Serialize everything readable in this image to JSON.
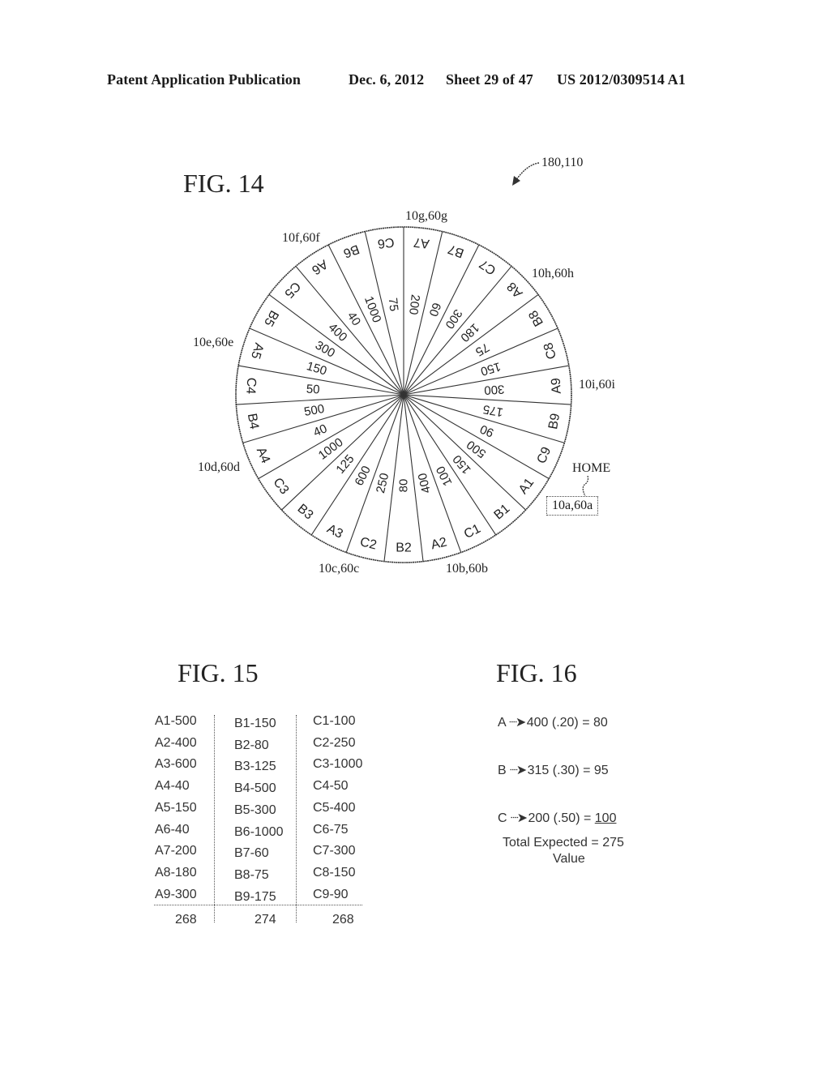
{
  "header": {
    "publication": "Patent Application Publication",
    "date": "Dec. 6, 2012",
    "sheet": "Sheet 29 of 47",
    "number": "US 2012/0309514 A1"
  },
  "fig14": {
    "title": "FIG. 14",
    "ref_label": "180,110",
    "home_label": "HOME",
    "home_ref": "10a,60a",
    "position_labels": {
      "b": "10b,60b",
      "c": "10c,60c",
      "d": "10d,60d",
      "e": "10e,60e",
      "f": "10f,60f",
      "g": "10g,60g",
      "h": "10h,60h",
      "i": "10i,60i"
    },
    "segments": [
      {
        "label": "A7",
        "value": "200"
      },
      {
        "label": "B7",
        "value": "60"
      },
      {
        "label": "C7",
        "value": "300"
      },
      {
        "label": "A8",
        "value": "180"
      },
      {
        "label": "B8",
        "value": "75"
      },
      {
        "label": "C8",
        "value": "150"
      },
      {
        "label": "A9",
        "value": "300"
      },
      {
        "label": "B9",
        "value": "175"
      },
      {
        "label": "C9",
        "value": "90"
      },
      {
        "label": "A1",
        "value": "500"
      },
      {
        "label": "B1",
        "value": "150"
      },
      {
        "label": "C1",
        "value": "100"
      },
      {
        "label": "A2",
        "value": "400"
      },
      {
        "label": "B2",
        "value": "80"
      },
      {
        "label": "C2",
        "value": "250"
      },
      {
        "label": "A3",
        "value": "600"
      },
      {
        "label": "B3",
        "value": "125"
      },
      {
        "label": "C3",
        "value": "1000"
      },
      {
        "label": "A4",
        "value": "40"
      },
      {
        "label": "B4",
        "value": "500"
      },
      {
        "label": "C4",
        "value": "50"
      },
      {
        "label": "A5",
        "value": "150"
      },
      {
        "label": "B5",
        "value": "300"
      },
      {
        "label": "C5",
        "value": "400"
      },
      {
        "label": "A6",
        "value": "40"
      },
      {
        "label": "B6",
        "value": "1000"
      },
      {
        "label": "C6",
        "value": "75"
      }
    ]
  },
  "fig15": {
    "title": "FIG. 15",
    "columns": [
      {
        "rows": [
          "A1-500",
          "A2-400",
          "A3-600",
          "A4-40",
          "A5-150",
          "A6-40",
          "A7-200",
          "A8-180",
          "A9-300"
        ],
        "total": "268"
      },
      {
        "rows": [
          "B1-150",
          "B2-80",
          "B3-125",
          "B4-500",
          "B5-300",
          "B6-1000",
          "B7-60",
          "B8-75",
          "B9-175"
        ],
        "total": "274"
      },
      {
        "rows": [
          "C1-100",
          "C2-250",
          "C3-1000",
          "C4-50",
          "C5-400",
          "C6-75",
          "C7-300",
          "C8-150",
          "C9-90"
        ],
        "total": "268"
      }
    ]
  },
  "fig16": {
    "title": "FIG. 16",
    "lines": [
      {
        "letter": "A",
        "arrow": "→",
        "expr": "400 (.20) = ",
        "result": "80"
      },
      {
        "letter": "B",
        "arrow": "→",
        "expr": "315 (.30) = ",
        "result": "95"
      },
      {
        "letter": "C",
        "arrow": "→",
        "expr": "200 (.50) = ",
        "result": "100"
      }
    ],
    "total_line1": "Total Expected = 275",
    "total_line2": "Value"
  }
}
